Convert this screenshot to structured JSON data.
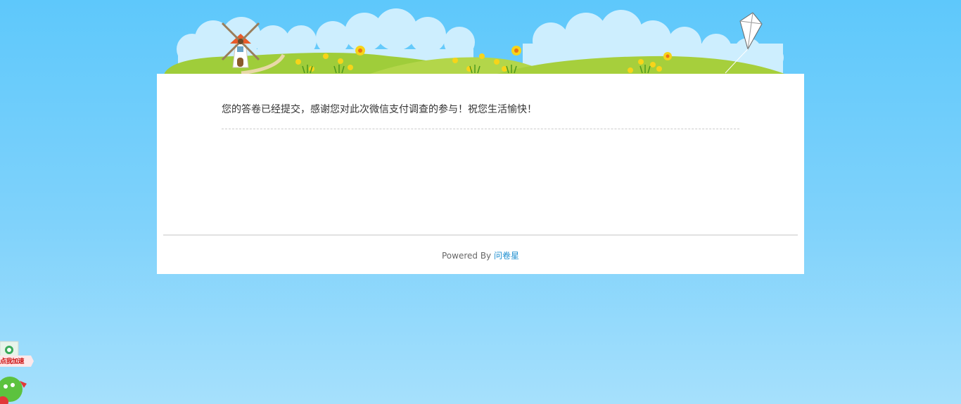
{
  "page": {
    "background_color": "#6fcdfb"
  },
  "banner": {
    "windmill_icon": "windmill-icon",
    "kite_icon": "kite-icon",
    "flower_icon": "flower-icon"
  },
  "content": {
    "message": "您的答卷已经提交，感谢您对此次微信支付调查的参与！祝您生活愉快！"
  },
  "footer": {
    "powered_by": "Powered By",
    "brand_link": "问卷星",
    "brand_color": "#1e8fd0"
  },
  "widget": {
    "label": "点我加速",
    "icon": "speed-boost-icon"
  }
}
